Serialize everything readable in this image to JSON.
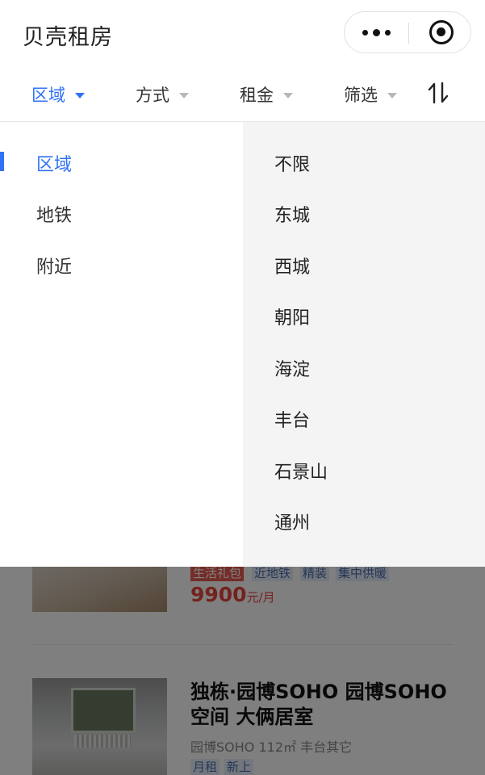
{
  "app": {
    "title": "贝壳租房"
  },
  "filters": [
    {
      "label": "区域",
      "active": true
    },
    {
      "label": "方式",
      "active": false
    },
    {
      "label": "租金",
      "active": false
    },
    {
      "label": "筛选",
      "active": false
    }
  ],
  "dropdown": {
    "categories": [
      {
        "label": "区域",
        "active": true
      },
      {
        "label": "地铁",
        "active": false
      },
      {
        "label": "附近",
        "active": false
      }
    ],
    "options": [
      "不限",
      "东城",
      "西城",
      "朝阳",
      "海淀",
      "丰台",
      "石景山",
      "通州"
    ]
  },
  "listings": [
    {
      "tags": [
        {
          "text": "生活礼包",
          "style": "red"
        },
        {
          "text": "近地铁",
          "style": "blue"
        },
        {
          "text": "精装",
          "style": "blue"
        },
        {
          "text": "集中供暖",
          "style": "blue"
        }
      ],
      "price": "9900",
      "price_unit": "元/月"
    },
    {
      "title": "独栋·园博SOHO 园博SOHO空间 大俩居室",
      "info": "园博SOHO 112㎡ 丰台其它",
      "tags": [
        {
          "text": "月租",
          "style": "blue"
        },
        {
          "text": "新上",
          "style": "blue"
        }
      ]
    }
  ],
  "colors": {
    "accent": "#3072f6",
    "price": "#e8453c",
    "dropdown_right_bg": "#f4f4f4"
  },
  "icons": [
    "more-dots-icon",
    "close-target-icon",
    "caret-down-icon",
    "sort-icon"
  ]
}
